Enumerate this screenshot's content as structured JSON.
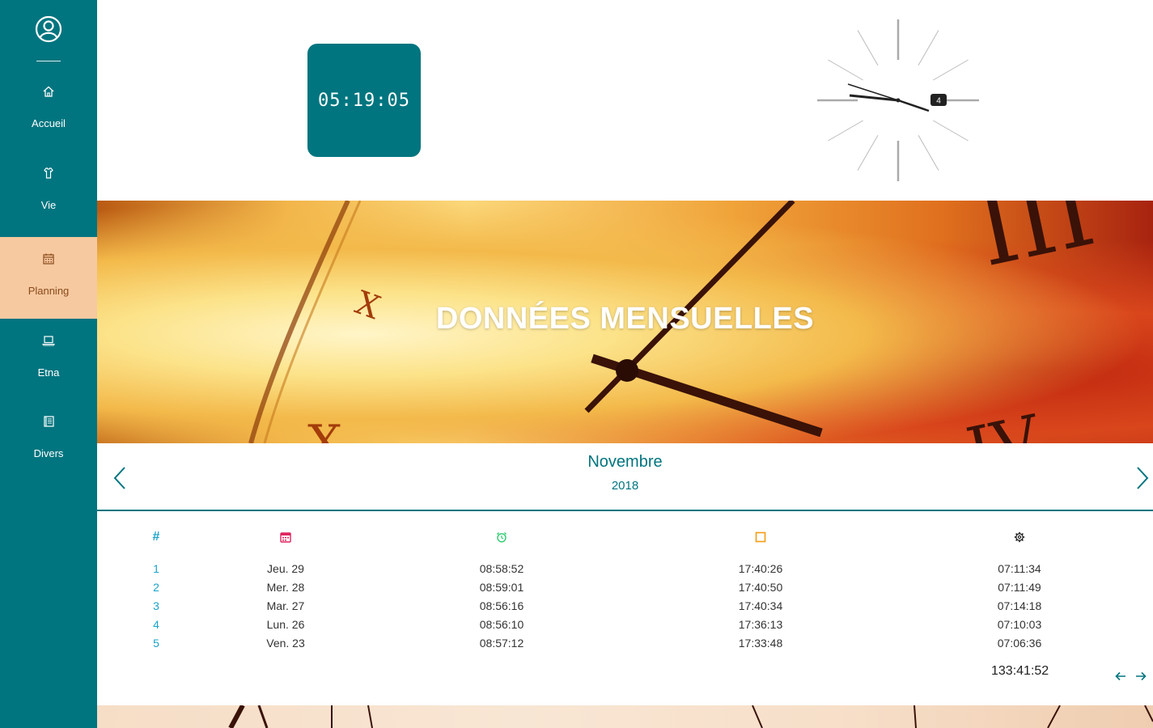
{
  "sidebar": {
    "items": [
      {
        "label": "Accueil",
        "icon": "home-icon"
      },
      {
        "label": "Vie",
        "icon": "shirt-icon"
      },
      {
        "label": "Planning",
        "icon": "calendar-icon",
        "active": true
      },
      {
        "label": "Etna",
        "icon": "laptop-icon"
      },
      {
        "label": "Divers",
        "icon": "book-icon"
      }
    ]
  },
  "header": {
    "digital_time": "05:19:05",
    "analog_clock_date": "4"
  },
  "banner": {
    "title": "DONNÉES MENSUELLES"
  },
  "calendar": {
    "month": "Novembre",
    "year": "2018"
  },
  "table": {
    "header_icons": [
      "hash-icon",
      "calendar-icon",
      "alarm-clock-icon",
      "square-icon",
      "gear-icon"
    ],
    "rows": [
      {
        "num": "1",
        "date": "Jeu. 29",
        "arrival": "08:58:52",
        "departure": "17:40:26",
        "total": "07:11:34"
      },
      {
        "num": "2",
        "date": "Mer. 28",
        "arrival": "08:59:01",
        "departure": "17:40:50",
        "total": "07:11:49"
      },
      {
        "num": "3",
        "date": "Mar. 27",
        "arrival": "08:56:16",
        "departure": "17:40:34",
        "total": "07:14:18"
      },
      {
        "num": "4",
        "date": "Lun. 26",
        "arrival": "08:56:10",
        "departure": "17:36:13",
        "total": "07:10:03"
      },
      {
        "num": "5",
        "date": "Ven. 23",
        "arrival": "08:57:12",
        "departure": "17:33:48",
        "total": "07:06:36"
      }
    ],
    "sum_total": "133:41:52"
  },
  "colors": {
    "primary": "#00757f",
    "active_nav": "#f6c9a0",
    "hash": "#1aa4c8",
    "calendar_icon": "#e0245e",
    "alarm_icon": "#2ecc71",
    "square_icon": "#f39c12"
  }
}
